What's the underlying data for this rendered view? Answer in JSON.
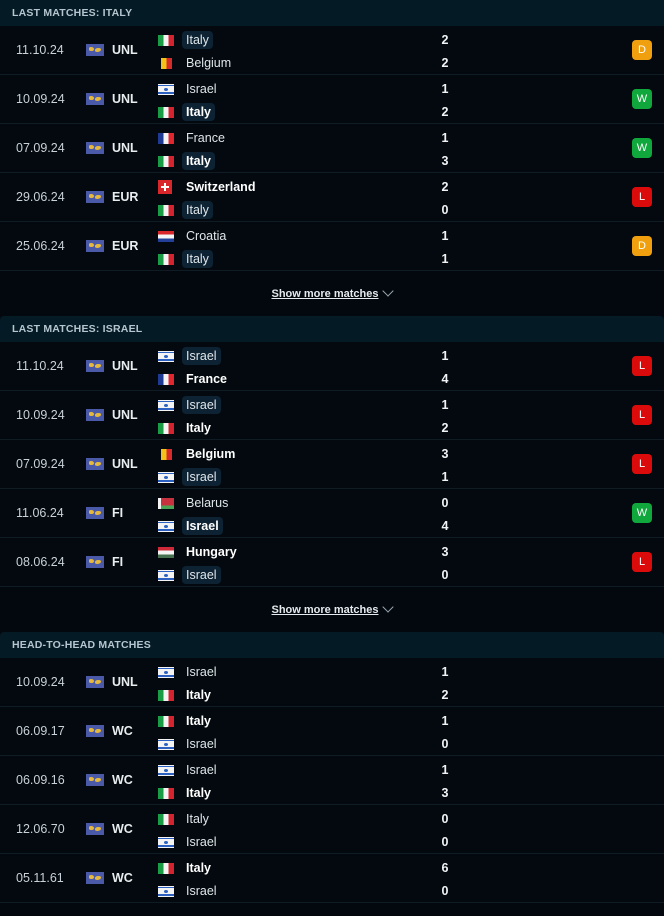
{
  "sections": [
    {
      "title": "LAST MATCHES: ITALY",
      "show_more": "Show more matches",
      "matches": [
        {
          "date": "11.10.24",
          "comp": "UNL",
          "home": {
            "name": "Italy",
            "flag": "italy",
            "bold": false,
            "focus": true
          },
          "away": {
            "name": "Belgium",
            "flag": "belgium",
            "bold": false,
            "focus": false
          },
          "home_score": "2",
          "away_score": "2",
          "result": "D"
        },
        {
          "date": "10.09.24",
          "comp": "UNL",
          "home": {
            "name": "Israel",
            "flag": "israel",
            "bold": false,
            "focus": false
          },
          "away": {
            "name": "Italy",
            "flag": "italy",
            "bold": true,
            "focus": true
          },
          "home_score": "1",
          "away_score": "2",
          "result": "W"
        },
        {
          "date": "07.09.24",
          "comp": "UNL",
          "home": {
            "name": "France",
            "flag": "france",
            "bold": false,
            "focus": false
          },
          "away": {
            "name": "Italy",
            "flag": "italy",
            "bold": true,
            "focus": true
          },
          "home_score": "1",
          "away_score": "3",
          "result": "W"
        },
        {
          "date": "29.06.24",
          "comp": "EUR",
          "home": {
            "name": "Switzerland",
            "flag": "switzerland",
            "bold": true,
            "focus": false
          },
          "away": {
            "name": "Italy",
            "flag": "italy",
            "bold": false,
            "focus": true
          },
          "home_score": "2",
          "away_score": "0",
          "result": "L"
        },
        {
          "date": "25.06.24",
          "comp": "EUR",
          "home": {
            "name": "Croatia",
            "flag": "croatia",
            "bold": false,
            "focus": false
          },
          "away": {
            "name": "Italy",
            "flag": "italy",
            "bold": false,
            "focus": true
          },
          "home_score": "1",
          "away_score": "1",
          "result": "D"
        }
      ]
    },
    {
      "title": "LAST MATCHES: ISRAEL",
      "show_more": "Show more matches",
      "matches": [
        {
          "date": "11.10.24",
          "comp": "UNL",
          "home": {
            "name": "Israel",
            "flag": "israel",
            "bold": false,
            "focus": true
          },
          "away": {
            "name": "France",
            "flag": "france",
            "bold": true,
            "focus": false
          },
          "home_score": "1",
          "away_score": "4",
          "result": "L"
        },
        {
          "date": "10.09.24",
          "comp": "UNL",
          "home": {
            "name": "Israel",
            "flag": "israel",
            "bold": false,
            "focus": true
          },
          "away": {
            "name": "Italy",
            "flag": "italy",
            "bold": true,
            "focus": false
          },
          "home_score": "1",
          "away_score": "2",
          "result": "L"
        },
        {
          "date": "07.09.24",
          "comp": "UNL",
          "home": {
            "name": "Belgium",
            "flag": "belgium",
            "bold": true,
            "focus": false
          },
          "away": {
            "name": "Israel",
            "flag": "israel",
            "bold": false,
            "focus": true
          },
          "home_score": "3",
          "away_score": "1",
          "result": "L"
        },
        {
          "date": "11.06.24",
          "comp": "FI",
          "home": {
            "name": "Belarus",
            "flag": "belarus",
            "bold": false,
            "focus": false
          },
          "away": {
            "name": "Israel",
            "flag": "israel",
            "bold": true,
            "focus": true
          },
          "home_score": "0",
          "away_score": "4",
          "result": "W"
        },
        {
          "date": "08.06.24",
          "comp": "FI",
          "home": {
            "name": "Hungary",
            "flag": "hungary",
            "bold": true,
            "focus": false
          },
          "away": {
            "name": "Israel",
            "flag": "israel",
            "bold": false,
            "focus": true
          },
          "home_score": "3",
          "away_score": "0",
          "result": "L"
        }
      ]
    },
    {
      "title": "HEAD-TO-HEAD MATCHES",
      "show_more": null,
      "matches": [
        {
          "date": "10.09.24",
          "comp": "UNL",
          "home": {
            "name": "Israel",
            "flag": "israel",
            "bold": false,
            "focus": false
          },
          "away": {
            "name": "Italy",
            "flag": "italy",
            "bold": true,
            "focus": false
          },
          "home_score": "1",
          "away_score": "2",
          "result": null
        },
        {
          "date": "06.09.17",
          "comp": "WC",
          "home": {
            "name": "Italy",
            "flag": "italy",
            "bold": true,
            "focus": false
          },
          "away": {
            "name": "Israel",
            "flag": "israel",
            "bold": false,
            "focus": false
          },
          "home_score": "1",
          "away_score": "0",
          "result": null
        },
        {
          "date": "06.09.16",
          "comp": "WC",
          "home": {
            "name": "Israel",
            "flag": "israel",
            "bold": false,
            "focus": false
          },
          "away": {
            "name": "Italy",
            "flag": "italy",
            "bold": true,
            "focus": false
          },
          "home_score": "1",
          "away_score": "3",
          "result": null
        },
        {
          "date": "12.06.70",
          "comp": "WC",
          "home": {
            "name": "Italy",
            "flag": "italy",
            "bold": false,
            "focus": false
          },
          "away": {
            "name": "Israel",
            "flag": "israel",
            "bold": false,
            "focus": false
          },
          "home_score": "0",
          "away_score": "0",
          "result": null
        },
        {
          "date": "05.11.61",
          "comp": "WC",
          "home": {
            "name": "Italy",
            "flag": "italy",
            "bold": true,
            "focus": false
          },
          "away": {
            "name": "Israel",
            "flag": "israel",
            "bold": false,
            "focus": false
          },
          "home_score": "6",
          "away_score": "0",
          "result": null
        }
      ]
    }
  ],
  "icons": {
    "competition": "world-map-icon",
    "show_more": "chevron-down-icon"
  },
  "colors": {
    "draw": "#f0a00f",
    "win": "#10a83c",
    "loss": "#dc0b0b",
    "header_bg": "#041a24",
    "page_bg": "#02080d"
  }
}
